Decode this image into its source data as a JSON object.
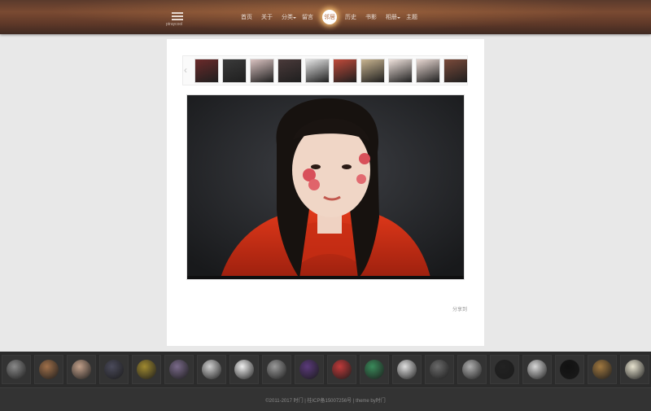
{
  "header": {
    "menu_label": "ptraycool",
    "nav": [
      {
        "label": "首页",
        "sub": false,
        "active": false
      },
      {
        "label": "关于",
        "sub": false,
        "active": false
      },
      {
        "label": "分类",
        "sub": true,
        "active": false
      },
      {
        "label": "留言",
        "sub": false,
        "active": false
      },
      {
        "label": "邻居",
        "sub": false,
        "active": true
      },
      {
        "label": "历史",
        "sub": false,
        "active": false
      },
      {
        "label": "书影",
        "sub": false,
        "active": false
      },
      {
        "label": "相册",
        "sub": true,
        "active": false
      },
      {
        "label": "主题",
        "sub": false,
        "active": false
      }
    ],
    "accent": "#b06a3c"
  },
  "gallery": {
    "prev_arrow": "‹",
    "thumb_colors": [
      "#6b2a2a",
      "#3a3a3a",
      "#d9c2c0",
      "#4a3a3a",
      "#e6e6e6",
      "#c04a3a",
      "#c8b490",
      "#efe2dc",
      "#e8d8d2",
      "#7a4a3a"
    ],
    "share_label": "分享到"
  },
  "neighbors": {
    "avatar_colors": [
      "#8a8a8a",
      "#a0704a",
      "#c2a08a",
      "#4a4a5a",
      "#a08a30",
      "#7a6a8a",
      "#d0d0d0",
      "#f0f0f0",
      "#9a9a9a",
      "#5a3a7a",
      "#c03a3a",
      "#3a8a5a",
      "#e0e0e0",
      "#6a6a6a",
      "#b0b0b0",
      "#222222",
      "#d8d8d8",
      "#111111",
      "#a07840",
      "#e8e4d0"
    ]
  },
  "footer": {
    "text": "©2011-2017 时门 | 桂ICP备15007256号 | theme by时门"
  }
}
